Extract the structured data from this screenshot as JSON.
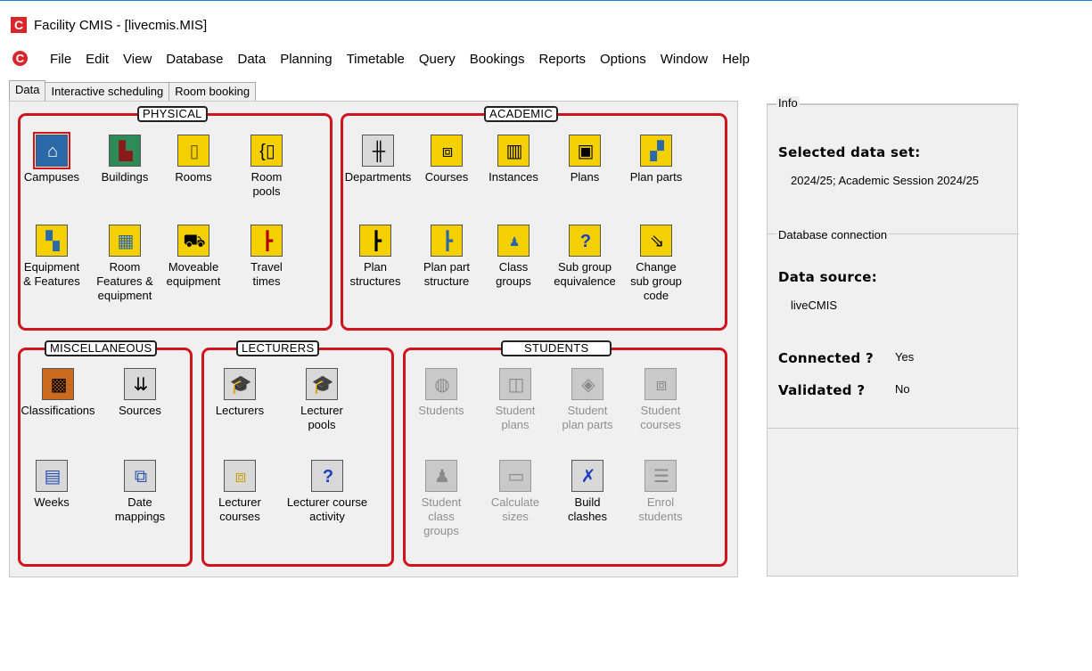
{
  "window": {
    "title": "Facility CMIS - [livecmis.MIS]",
    "logo_letter": "C"
  },
  "menu": [
    "File",
    "Edit",
    "View",
    "Database",
    "Data",
    "Planning",
    "Timetable",
    "Query",
    "Bookings",
    "Reports",
    "Options",
    "Window",
    "Help"
  ],
  "tabs": {
    "data": "Data",
    "interactive": "Interactive scheduling",
    "room": "Room booking"
  },
  "groups": {
    "physical": "PHYSICAL",
    "academic": "ACADEMIC",
    "misc": "MISCELLANEOUS",
    "lecturers": "LECTURERS",
    "students": "STUDENTS"
  },
  "physical": {
    "campuses": "Campuses",
    "buildings": "Buildings",
    "rooms": "Rooms",
    "room_pools_1": "Room",
    "room_pools_2": "pools",
    "equip_1": "Equipment",
    "equip_2": "& Features",
    "room_feat_1": "Room",
    "room_feat_2": "Features &",
    "room_feat_3": "equipment",
    "moveable_1": "Moveable",
    "moveable_2": "equipment",
    "travel_1": "Travel",
    "travel_2": "times"
  },
  "academic": {
    "departments": "Departments",
    "courses": "Courses",
    "instances": "Instances",
    "plans": "Plans",
    "plan_parts": "Plan parts",
    "plan_structures_1": "Plan",
    "plan_structures_2": "structures",
    "plan_part_structure_1": "Plan part",
    "plan_part_structure_2": "structure",
    "class_groups_1": "Class",
    "class_groups_2": "groups",
    "sub_group_equiv_1": "Sub group",
    "sub_group_equiv_2": "equivalence",
    "change_sub_1": "Change",
    "change_sub_2": "sub group",
    "change_sub_3": "code"
  },
  "misc": {
    "classifications": "Classifications",
    "sources": "Sources",
    "weeks": "Weeks",
    "date_map_1": "Date",
    "date_map_2": "mappings"
  },
  "lecturers": {
    "lecturers": "Lecturers",
    "pools_1": "Lecturer",
    "pools_2": "pools",
    "courses_1": "Lecturer",
    "courses_2": "courses",
    "activity_1": "Lecturer course",
    "activity_2": "activity"
  },
  "students": {
    "students": "Students",
    "plans_1": "Student",
    "plans_2": "plans",
    "plan_parts_1": "Student",
    "plan_parts_2": "plan parts",
    "courses_1": "Student",
    "courses_2": "courses",
    "class_groups_1": "Student",
    "class_groups_2": "class",
    "class_groups_3": "groups",
    "calc_1": "Calculate",
    "calc_2": "sizes",
    "build_1": "Build",
    "build_2": "clashes",
    "enrol_1": "Enrol",
    "enrol_2": "students"
  },
  "info": {
    "section_label": "Info",
    "selected_heading": "Selected data set:",
    "selected_value": "2024/25; Academic Session 2024/25",
    "db_label": "Database connection",
    "source_heading": "Data source:",
    "source_value": "liveCMIS",
    "connected_heading": "Connected ?",
    "connected_value": "Yes",
    "validated_heading": "Validated ?",
    "validated_value": "No"
  }
}
